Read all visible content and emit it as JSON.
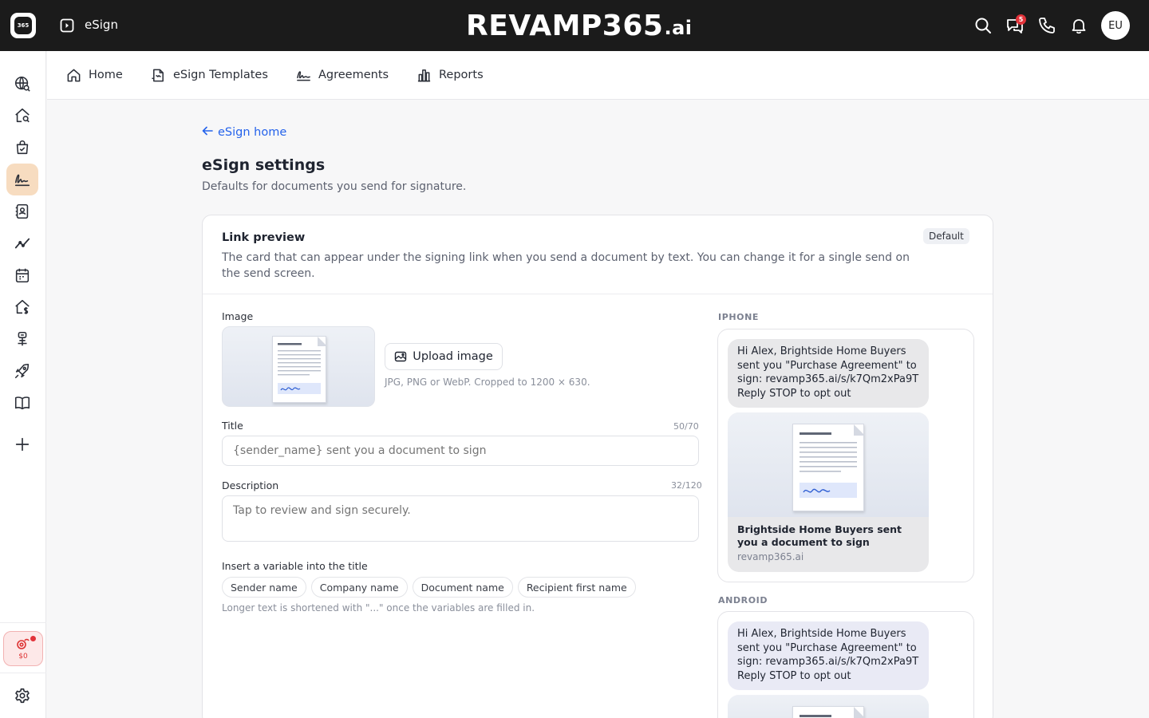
{
  "topbar": {
    "app_logo_text": "365",
    "app_name": "eSign",
    "brand_main": "REVAMP365",
    "brand_suffix": ".ai",
    "notification_count": "5",
    "avatar_initials": "EU"
  },
  "subnav": {
    "tabs": [
      {
        "label": "Home",
        "icon": "home-icon"
      },
      {
        "label": "eSign Templates",
        "icon": "template-icon"
      },
      {
        "label": "Agreements",
        "icon": "signature-icon"
      },
      {
        "label": "Reports",
        "icon": "bar-chart-icon"
      }
    ]
  },
  "rail": {
    "items": [
      "globe-search-icon",
      "home-search-icon",
      "shopping-bag-icon",
      "signature-icon",
      "contacts-book-icon",
      "trend-line-icon",
      "calendar-icon",
      "home-dollar-icon",
      "tree-icon",
      "rocket-icon",
      "book-icon",
      "plus-icon"
    ],
    "active_item": "signature-icon",
    "credit_amount": "$0",
    "settings_icon": "gear-icon"
  },
  "page": {
    "back_link": "eSign home",
    "title": "eSign settings",
    "subtitle": "Defaults for documents you send for signature."
  },
  "link_preview": {
    "title": "Link preview",
    "description": "The card that can appear under the signing link when you send a document by text. You can change it for a single send on the send screen.",
    "badge": "Default",
    "image_label": "Image",
    "upload_button": "Upload image",
    "upload_hint": "JPG, PNG or WebP. Cropped to 1200 × 630.",
    "title_label": "Title",
    "title_counter": "50/70",
    "title_placeholder": "{sender_name} sent you a document to sign",
    "description_label": "Description",
    "description_counter": "32/120",
    "description_placeholder": "Tap to review and sign securely.",
    "variables_label": "Insert a variable into the title",
    "variables": [
      "Sender name",
      "Company name",
      "Document name",
      "Recipient first name"
    ],
    "variables_hint": "Longer text is shortened with \"...\" once the variables are filled in."
  },
  "previews": {
    "iphone": {
      "label": "IPHONE",
      "message": "Hi Alex, Brightside Home Buyers sent you \"Purchase Agreement\" to sign: revamp365.ai/s/k7Qm2xPa9T Reply STOP to opt out",
      "card_title": "Brightside Home Buyers sent you a document to sign",
      "card_domain": "revamp365.ai"
    },
    "android": {
      "label": "ANDROID",
      "message": "Hi Alex, Brightside Home Buyers sent you \"Purchase Agreement\" to sign: revamp365.ai/s/k7Qm2xPa9T Reply STOP to opt out"
    }
  },
  "colors": {
    "topbar_bg": "#1b1b1b",
    "accent_link": "#2563eb",
    "active_rail": "#f7dcc0",
    "notification": "#e2333a"
  }
}
